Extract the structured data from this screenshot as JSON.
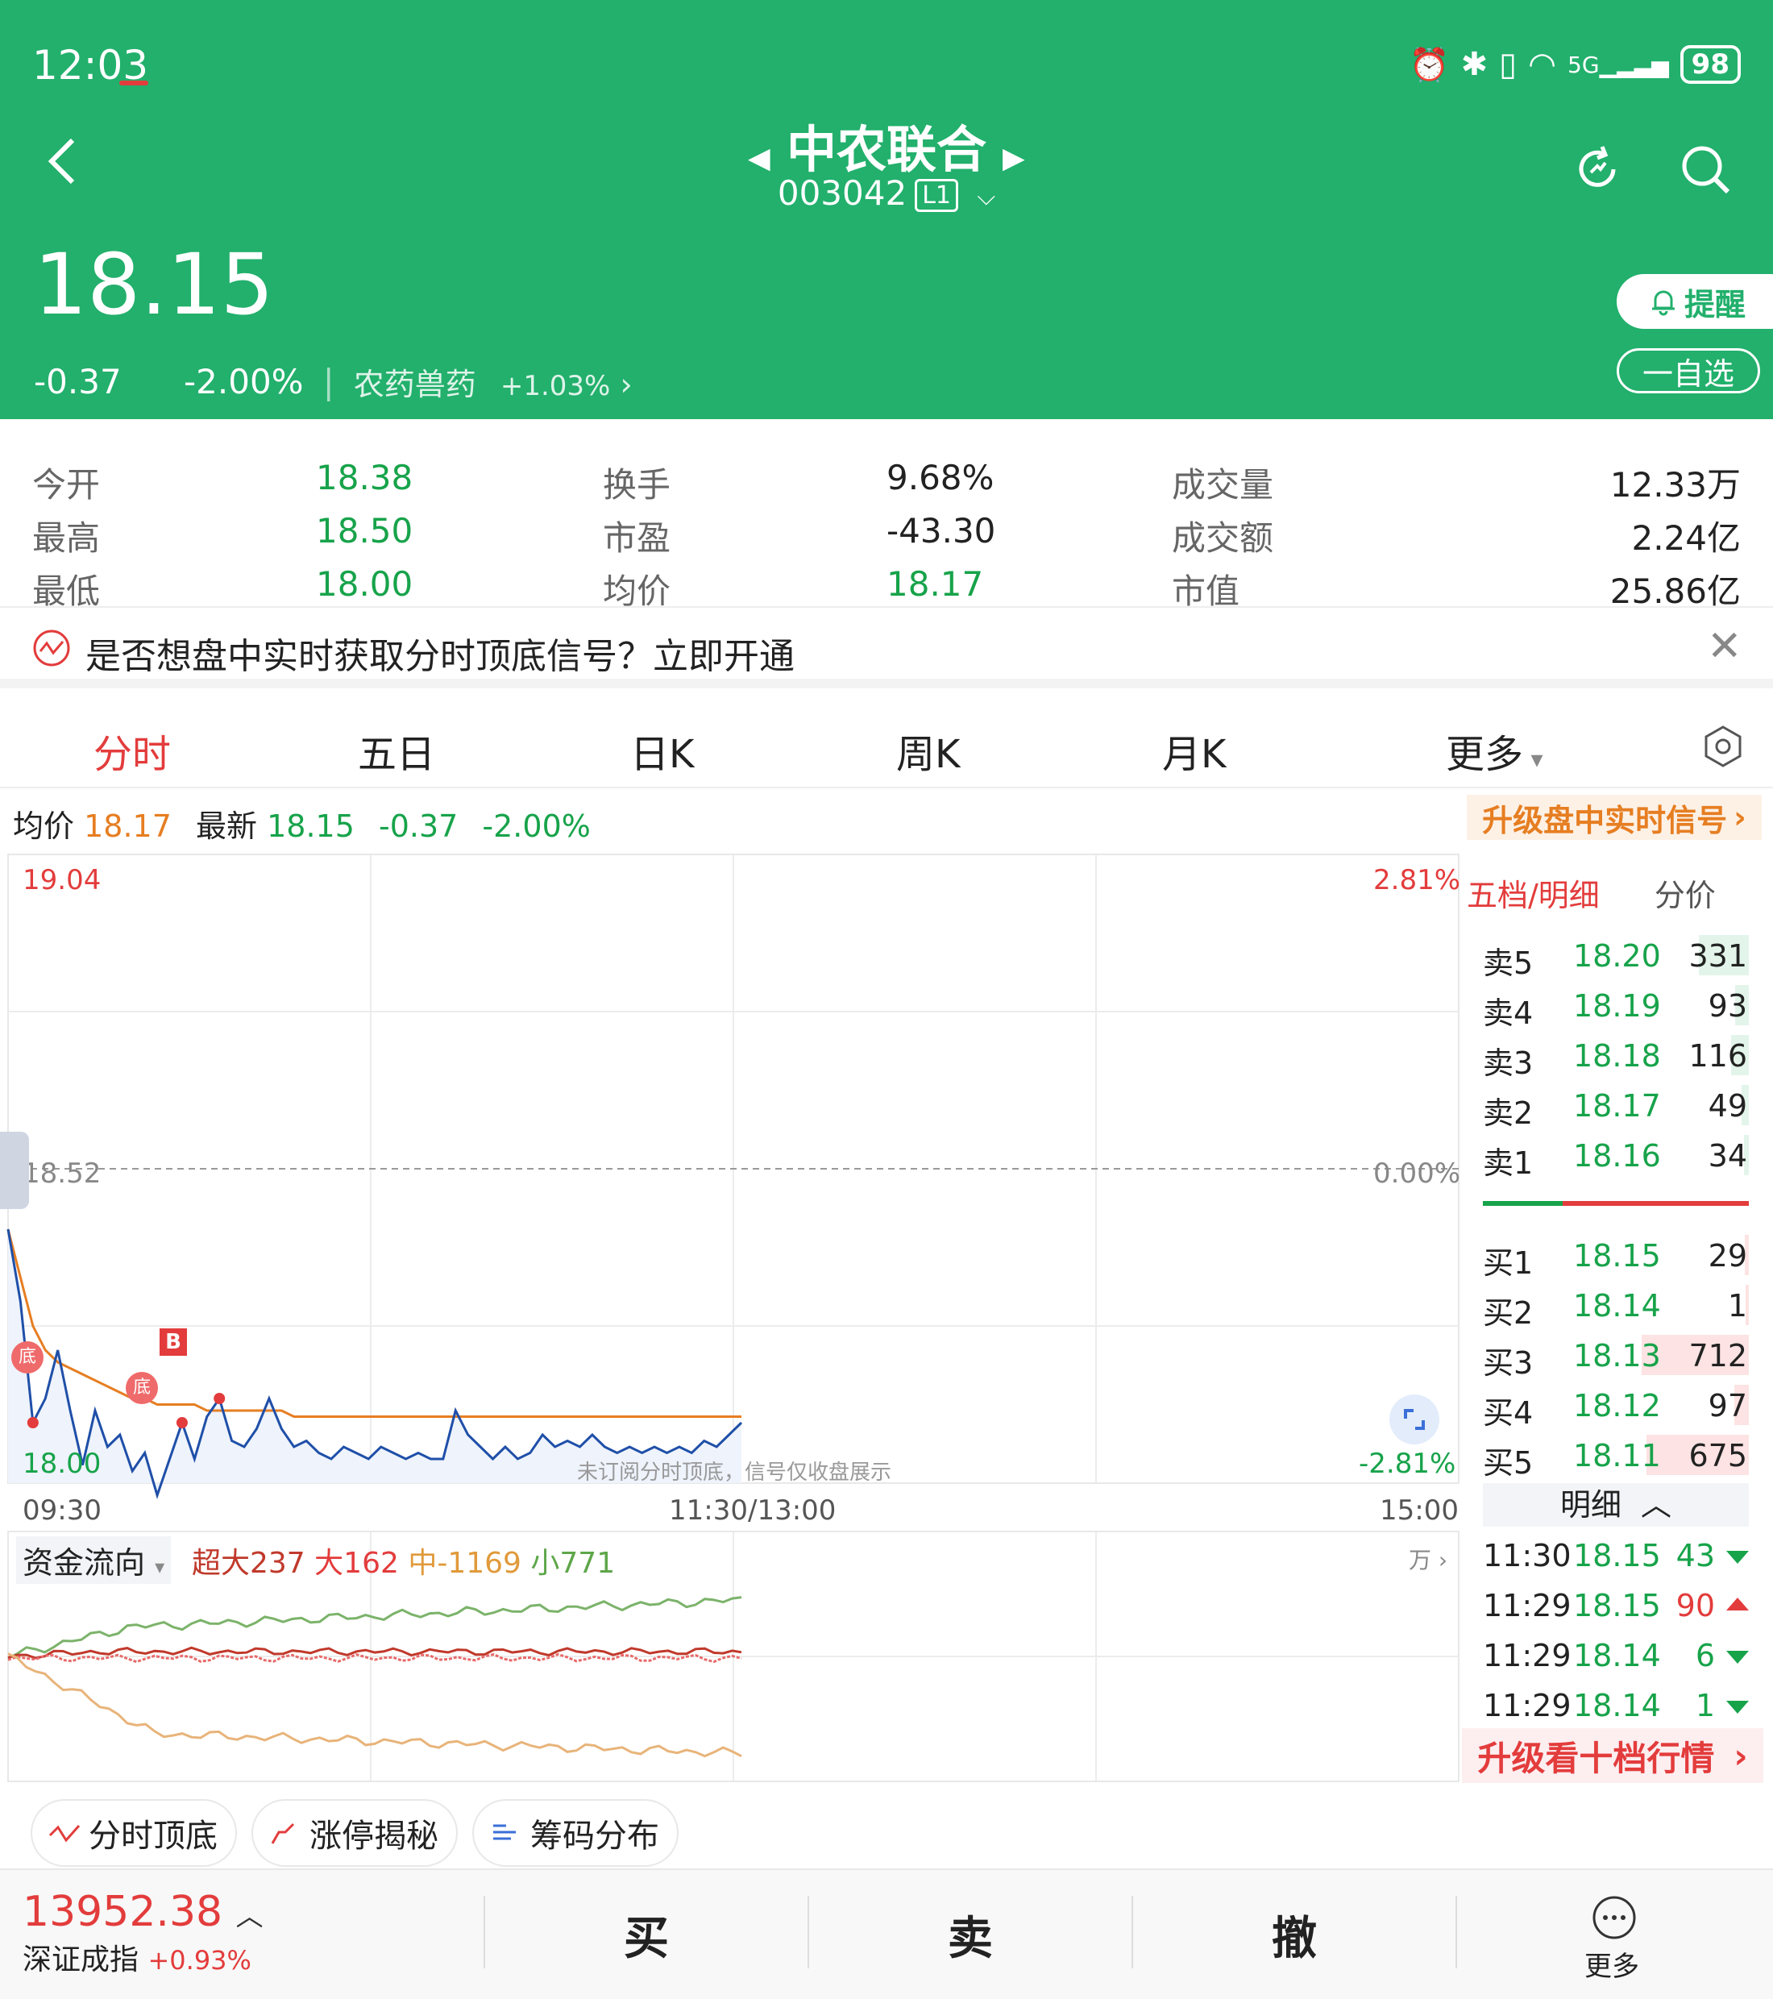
{
  "status": {
    "time": "12:03",
    "battery": "98",
    "net": "5G"
  },
  "header": {
    "stock_name": "中农联合",
    "stock_code": "003042",
    "code_tag": "L1",
    "price": "18.15",
    "change": "-0.37",
    "change_pct": "-2.00%",
    "sector": "农药兽药",
    "sector_change": "+1.03%",
    "alert_label": "提醒",
    "watch_label": "一自选"
  },
  "stats": [
    {
      "label": "今开",
      "value": "18.38",
      "color": "green"
    },
    {
      "label": "最高",
      "value": "18.50",
      "color": "green"
    },
    {
      "label": "最低",
      "value": "18.00",
      "color": "green"
    },
    {
      "label": "换手",
      "value": "9.68%",
      "color": ""
    },
    {
      "label": "市盈",
      "value": "-43.30",
      "color": ""
    },
    {
      "label": "均价",
      "value": "18.17",
      "color": "green"
    },
    {
      "label": "成交量",
      "value": "12.33万",
      "color": ""
    },
    {
      "label": "成交额",
      "value": "2.24亿",
      "color": ""
    },
    {
      "label": "市值",
      "value": "25.86亿",
      "color": ""
    }
  ],
  "banner": {
    "text": "是否想盘中实时获取分时顶底信号？立即开通"
  },
  "tabs": [
    "分时",
    "五日",
    "日K",
    "周K",
    "月K",
    "更多"
  ],
  "info": {
    "avg_label": "均价",
    "avg_value": "18.17",
    "latest_label": "最新",
    "latest_value": "18.15",
    "change": "-0.37",
    "change_pct": "-2.00%",
    "upgrade_signal": "升级盘中实时信号"
  },
  "chart": {
    "top_price": "19.04",
    "mid_price": "18.52",
    "bottom_price": "18.00",
    "top_pct": "2.81%",
    "mid_pct": "0.00%",
    "bottom_pct": "-2.81%",
    "x_start": "09:30",
    "x_mid": "11:30/13:00",
    "x_end": "15:00",
    "marker_b": "B",
    "marker_di": "底",
    "note": "未订阅分时顶底，信号仅收盘展示"
  },
  "chart_data": {
    "type": "line",
    "ylim": [
      18.0,
      19.04
    ],
    "series": [
      {
        "values": [
          18.42,
          18.3,
          18.1,
          18.14,
          18.22,
          18.12,
          18.03,
          18.12,
          18.06,
          18.08,
          18.02,
          18.05,
          17.98,
          18.04,
          18.1,
          18.04,
          18.11,
          18.14,
          18.07,
          18.06,
          18.09,
          18.14,
          18.09,
          18.06,
          18.07,
          18.05,
          18.04,
          18.06,
          18.05,
          18.04,
          18.06,
          18.05,
          18.04,
          18.05,
          18.04,
          18.04,
          18.12,
          18.08,
          18.06,
          18.04,
          18.06,
          18.04,
          18.05,
          18.08,
          18.06,
          18.07,
          18.06,
          18.08,
          18.06,
          18.05,
          18.06,
          18.05,
          18.06,
          18.05,
          18.06,
          18.05,
          18.07,
          18.06,
          18.08,
          18.1
        ],
        "color": "#1f4fa8"
      },
      {
        "values": [
          18.42,
          18.34,
          18.26,
          18.22,
          18.2,
          18.19,
          18.18,
          18.17,
          18.16,
          18.15,
          18.14,
          18.14,
          18.13,
          18.13,
          18.13,
          18.13,
          18.12,
          18.12,
          18.12,
          18.12,
          18.12,
          18.12,
          18.12,
          18.11,
          18.11,
          18.11,
          18.11,
          18.11,
          18.11,
          18.11,
          18.11,
          18.11,
          18.11,
          18.11,
          18.11,
          18.11,
          18.11,
          18.11,
          18.11,
          18.11,
          18.11,
          18.11,
          18.11,
          18.11,
          18.11,
          18.11,
          18.11,
          18.11,
          18.11,
          18.11,
          18.11,
          18.11,
          18.11,
          18.11,
          18.11,
          18.11,
          18.11,
          18.11,
          18.11,
          18.11
        ],
        "color": "#e67e22"
      }
    ]
  },
  "orderbook": {
    "title": "五档/明细",
    "subtitle": "分价",
    "sells": [
      {
        "label": "卖5",
        "price": "18.20",
        "vol": "331",
        "v": 331
      },
      {
        "label": "卖4",
        "price": "18.19",
        "vol": "93",
        "v": 93
      },
      {
        "label": "卖3",
        "price": "18.18",
        "vol": "116",
        "v": 116
      },
      {
        "label": "卖2",
        "price": "18.17",
        "vol": "49",
        "v": 49
      },
      {
        "label": "卖1",
        "price": "18.16",
        "vol": "34",
        "v": 34
      }
    ],
    "buys": [
      {
        "label": "买1",
        "price": "18.15",
        "vol": "29",
        "v": 29
      },
      {
        "label": "买2",
        "price": "18.14",
        "vol": "1",
        "v": 1
      },
      {
        "label": "买3",
        "price": "18.13",
        "vol": "712",
        "v": 712
      },
      {
        "label": "买4",
        "price": "18.12",
        "vol": "97",
        "v": 97
      },
      {
        "label": "买5",
        "price": "18.11",
        "vol": "675",
        "v": 675
      }
    ],
    "detail_label": "明细",
    "ticks": [
      {
        "time": "11:30",
        "price": "18.15",
        "vol": "43",
        "dir": "down"
      },
      {
        "time": "11:29",
        "price": "18.15",
        "vol": "90",
        "dir": "up"
      },
      {
        "time": "11:29",
        "price": "18.14",
        "vol": "6",
        "dir": "down"
      },
      {
        "time": "11:29",
        "price": "18.14",
        "vol": "1",
        "dir": "down"
      }
    ],
    "upgrade_ten": "升级看十档行情"
  },
  "fundflow": {
    "label": "资金流向",
    "super_large": "超大237",
    "large": "大162",
    "medium": "中-1169",
    "small": "小771",
    "unit": "万"
  },
  "tools": [
    "分时顶底",
    "涨停揭秘",
    "筹码分布"
  ],
  "bottom": {
    "index_value": "13952.38",
    "index_name": "深证成指",
    "index_change": "+0.93%",
    "buy": "买",
    "sell": "卖",
    "cancel": "撤",
    "more": "更多"
  }
}
